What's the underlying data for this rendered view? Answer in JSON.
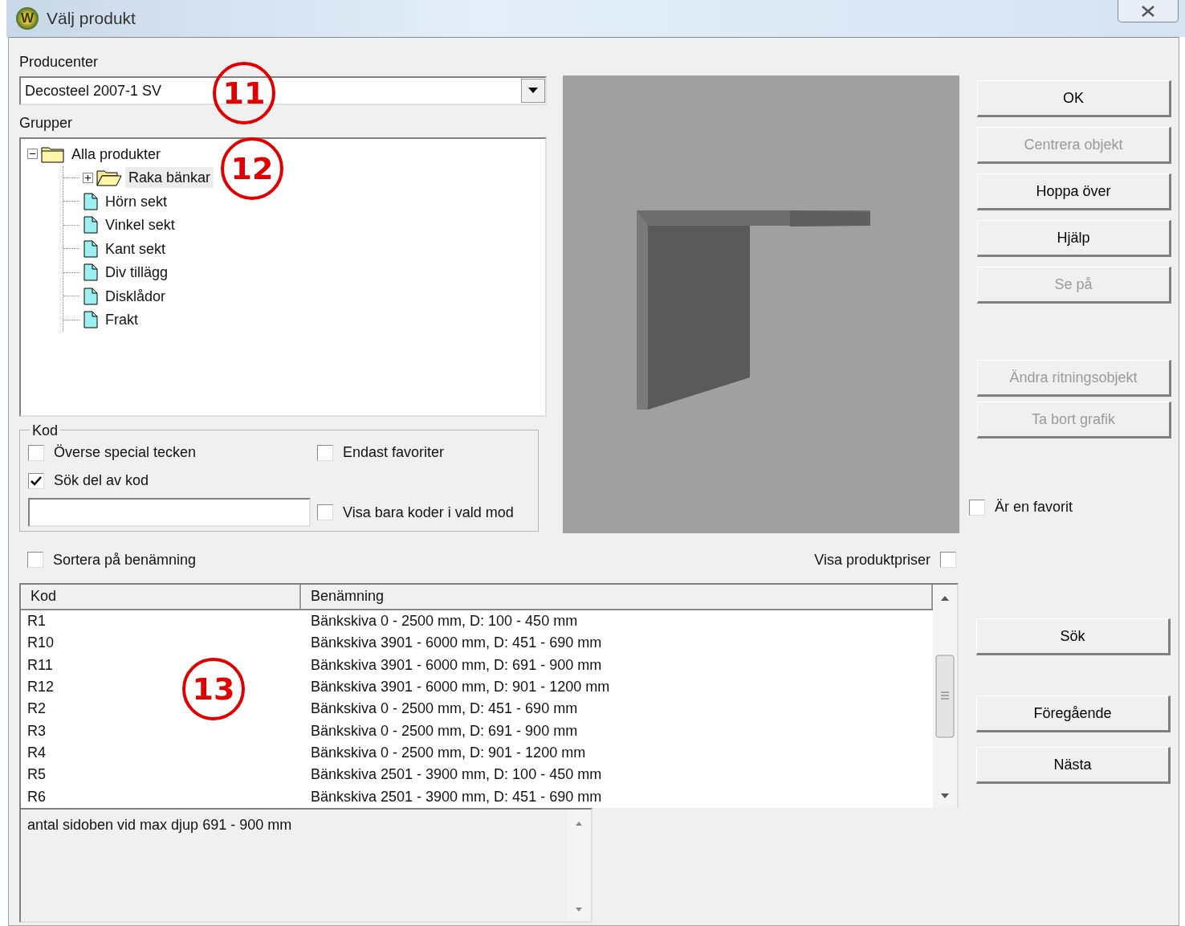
{
  "window": {
    "title": "Välj produkt",
    "icon_letter": "W"
  },
  "producer": {
    "label": "Producenter",
    "value": "Decosteel 2007-1 SV"
  },
  "groups": {
    "label": "Grupper",
    "tree": [
      {
        "label": "Alla produkter",
        "kind": "folder",
        "expanded": true,
        "selected": false,
        "children": [
          {
            "label": "Raka bänkar",
            "kind": "folder",
            "expanded": false,
            "selected": true
          },
          {
            "label": "Hörn sekt",
            "kind": "document",
            "selected": false
          },
          {
            "label": "Vinkel sekt",
            "kind": "document",
            "selected": false
          },
          {
            "label": "Kant sekt",
            "kind": "document",
            "selected": false
          },
          {
            "label": "Div tillägg",
            "kind": "document",
            "selected": false
          },
          {
            "label": "Disklådor",
            "kind": "document",
            "selected": false
          },
          {
            "label": "Frakt",
            "kind": "document",
            "selected": false
          }
        ]
      }
    ]
  },
  "code_box": {
    "title": "Kod",
    "options": [
      {
        "label": "Överse special tecken",
        "checked": false
      },
      {
        "label": "Endast favoriter",
        "checked": false
      },
      {
        "label": "Sök del av kod",
        "checked": true
      },
      {
        "label": "Visa bara koder i vald mod",
        "checked": false
      }
    ]
  },
  "buttons_top": [
    {
      "label": "OK",
      "disabled": false
    },
    {
      "label": "Centrera objekt",
      "disabled": true
    },
    {
      "label": "Hoppa över",
      "disabled": false
    },
    {
      "label": "Hjälp",
      "disabled": false
    },
    {
      "label": "Se på",
      "disabled": true
    }
  ],
  "buttons_edit": [
    {
      "label": "Ändra ritningsobjekt",
      "disabled": true
    },
    {
      "label": "Ta bort grafik",
      "disabled": true
    }
  ],
  "favorite": {
    "label": "Är en favorit",
    "checked": false
  },
  "sort_by_name": {
    "label": "Sortera på benämning",
    "checked": false
  },
  "show_prices": {
    "label": "Visa produktpriser",
    "checked": false
  },
  "table": {
    "columns": [
      "Kod",
      "Benämning"
    ],
    "rows": [
      {
        "code": "R1",
        "name": "Bänkskiva 0 - 2500 mm, D: 100 - 450 mm"
      },
      {
        "code": "R10",
        "name": "Bänkskiva 3901 - 6000 mm, D: 451 - 690 mm"
      },
      {
        "code": "R11",
        "name": "Bänkskiva 3901 - 6000 mm, D: 691 - 900 mm"
      },
      {
        "code": "R12",
        "name": "Bänkskiva 3901 - 6000 mm, D: 901 - 1200 mm"
      },
      {
        "code": "R2",
        "name": "Bänkskiva 0 - 2500 mm, D: 451 - 690 mm"
      },
      {
        "code": "R3",
        "name": "Bänkskiva 0 - 2500 mm, D: 691 - 900 mm"
      },
      {
        "code": "R4",
        "name": "Bänkskiva 0 - 2500 mm, D: 901 - 1200 mm"
      },
      {
        "code": "R5",
        "name": "Bänkskiva 2501 - 3900 mm, D: 100 - 450 mm"
      },
      {
        "code": "R6",
        "name": "Bänkskiva 2501 - 3900 mm, D: 451 - 690 mm"
      }
    ]
  },
  "buttons_search": [
    {
      "label": "Sök",
      "disabled": false
    }
  ],
  "buttons_nav": [
    {
      "label": "Föregående",
      "disabled": false
    },
    {
      "label": "Nästa",
      "disabled": false
    }
  ],
  "description": "antal sidoben vid max djup 691 - 900 mm",
  "callouts": [
    {
      "label": "11"
    },
    {
      "label": "12"
    },
    {
      "label": "13"
    }
  ]
}
